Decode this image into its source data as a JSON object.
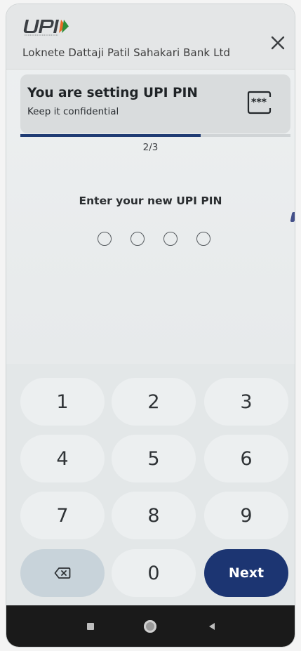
{
  "header": {
    "bank_name": "Loknete Dattaji Patil Sahakari Bank Ltd",
    "close_icon": "close-icon",
    "logo_text": "UPI"
  },
  "info_card": {
    "title": "You are setting UPI PIN",
    "subtitle": "Keep it confidential",
    "icon": "pin-dots-icon"
  },
  "progress": {
    "step_label": "2/3",
    "fraction": 0.667
  },
  "pin_entry": {
    "prompt": "Enter your new UPI PIN",
    "digits_total": 4,
    "digits_entered": 0
  },
  "keypad": {
    "keys": [
      "1",
      "2",
      "3",
      "4",
      "5",
      "6",
      "7",
      "8",
      "9"
    ],
    "zero": "0",
    "backspace_icon": "backspace-icon",
    "next_label": "Next"
  },
  "colors": {
    "accent": "#1c3572",
    "background": "#e8ebec"
  },
  "navbar": {
    "icons": [
      "recent-apps-icon",
      "home-icon",
      "back-icon"
    ]
  }
}
